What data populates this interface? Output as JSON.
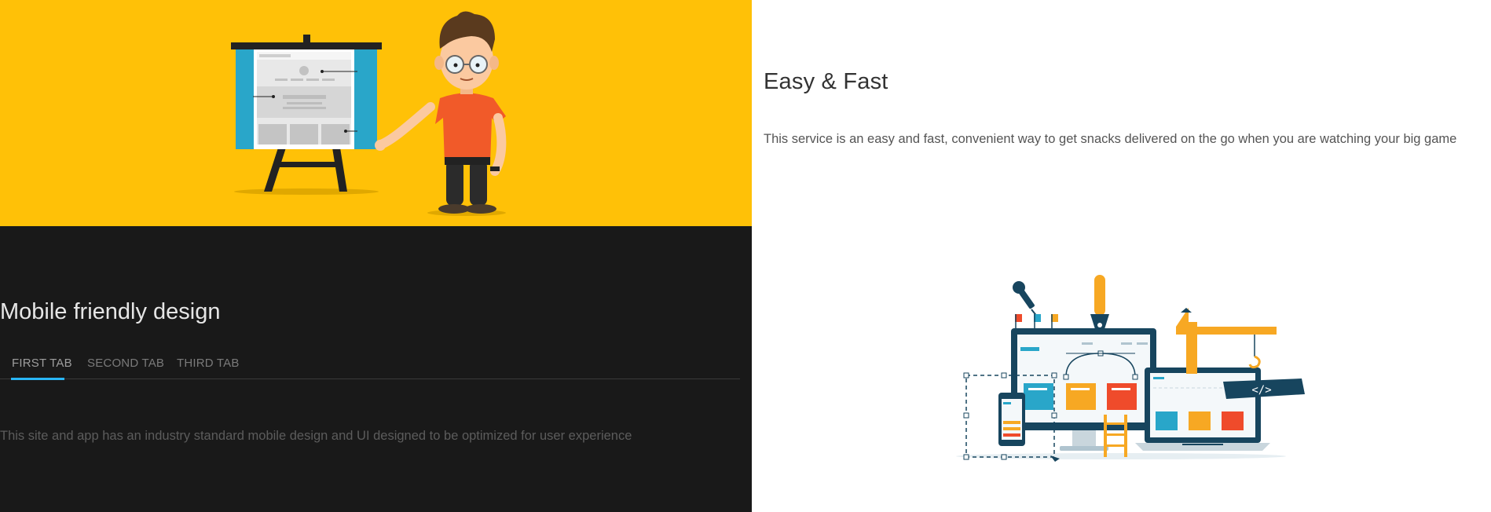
{
  "feature": {
    "title": "Easy & Fast",
    "description": "This service is an easy and fast, convenient way to get snacks delivered on the go when you are watching your big game"
  },
  "mobile_section": {
    "title": "Mobile friendly design",
    "tabs": [
      {
        "label": "FIRST TAB",
        "active": true
      },
      {
        "label": "SECOND TAB",
        "active": false
      },
      {
        "label": "THIRD TAB",
        "active": false
      }
    ],
    "tab_content": "This site and app has an industry standard mobile design and UI designed to be optimized for user experience"
  },
  "illustrations": {
    "hero": "presenter-with-board-illustration",
    "web": "web-design-devices-illustration",
    "code_tag": "</>"
  },
  "colors": {
    "hero_background": "#ffc107",
    "dark_background": "#191919",
    "tab_indicator": "#29b6f6",
    "shirt": "#f15a29",
    "board_blue": "#29a6c9",
    "navy": "#17455e",
    "orange_card": "#f7a823",
    "red_card": "#ef4b2b"
  }
}
